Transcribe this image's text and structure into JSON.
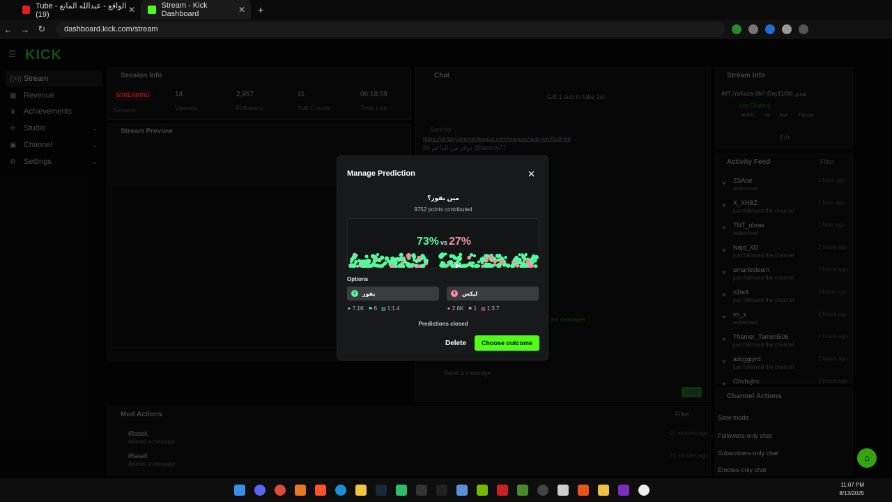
{
  "browser": {
    "tabs": [
      {
        "label": "Tube - الواقع - عبدالله المانع (19)",
        "color": "#e02020"
      },
      {
        "label": "Stream - Kick Dashboard",
        "color": "#53fc18"
      }
    ],
    "url": "dashboard.kick.com/stream"
  },
  "app": {
    "logo": "KICK",
    "sidebar": [
      {
        "label": "Stream",
        "icon": "broadcast-icon"
      },
      {
        "label": "Revenue",
        "icon": "dollar-icon"
      },
      {
        "label": "Achievements",
        "icon": "trophy-icon"
      },
      {
        "label": "Studio",
        "icon": "studio-icon"
      },
      {
        "label": "Channel",
        "icon": "channel-icon"
      },
      {
        "label": "Settings",
        "icon": "gear-icon"
      }
    ],
    "session_info": {
      "title": "Session Info",
      "badge": "STREAMING",
      "badge_sub": "Session",
      "stats": [
        {
          "value": "14",
          "label": "Viewers"
        },
        {
          "value": "2,957",
          "label": "Followers"
        },
        {
          "value": "11",
          "label": "Sub Counts"
        },
        {
          "value": "08:18:59",
          "label": "Time Live"
        }
      ]
    },
    "stream_preview": {
      "title": "Stream Preview"
    },
    "chat": {
      "title": "Chat",
      "gift": "Gift 1 sub to take 1st",
      "sent_by": "Sent by",
      "link": "https://fantasy.premierleague.com/leagues/auto-join/5o8n6d",
      "message_tail": "50 دولار من الداعم @kenroy77",
      "new_messages": "ew messages",
      "placeholder": "Send a message",
      "send": "Chat"
    },
    "stream_info": {
      "title": "Stream Info",
      "stream_title": "IMT |YaKuza |3k? |Day11/30| تحدي",
      "category": "Just Chatting",
      "tags": [
        "Arabic",
        "mt",
        "ksa",
        "Yakuza"
      ],
      "edit": "Edit"
    },
    "activity_feed": {
      "title": "Activity Feed",
      "filter": "Filter",
      "items": [
        {
          "name": "ZSAoe",
          "sub": "redeemed",
          "time": "1 hour ago"
        },
        {
          "name": "X_XHBZ",
          "sub": "just followed the channel",
          "time": "1 hour ago"
        },
        {
          "name": "TNT_nbras",
          "sub": "redeemed",
          "time": "1 hour ago"
        },
        {
          "name": "Najd_XD",
          "sub": "just followed the channel",
          "time": "2 hours ago"
        },
        {
          "name": "umartesleem",
          "sub": "just followed the channel",
          "time": "2 hours ago"
        },
        {
          "name": "n1le4",
          "sub": "just followed the channel",
          "time": "2 hours ago"
        },
        {
          "name": "vn_x",
          "sub": "redeemed",
          "time": "2 hours ago"
        },
        {
          "name": "Thamer_Tamimi506",
          "sub": "just followed the channel",
          "time": "2 hours ago"
        },
        {
          "name": "adcggtyrd",
          "sub": "just followed the channel",
          "time": "2 hours ago"
        },
        {
          "name": "Ghvhvjhv",
          "sub": "",
          "time": "2 hours ago"
        }
      ]
    },
    "mod_actions": {
      "title": "Mod Actions",
      "filter": "Filter",
      "items": [
        {
          "name": "iRaseil.",
          "sub": "deleted a message",
          "time": "21 minutes ago"
        },
        {
          "name": "iRaseil.",
          "sub": "deleted a message",
          "time": "21 minutes ago"
        }
      ]
    },
    "channel_actions": {
      "title": "Channel Actions",
      "items": [
        "Slow mode",
        "Followers-only chat",
        "Subscribers-only chat",
        "Emotes-only chat"
      ]
    }
  },
  "modal": {
    "title": "Manage Prediction",
    "question": "مين بفوز؟",
    "points": "9752 points contributed",
    "pct_a": "73%",
    "vs": "vs",
    "pct_b": "27%",
    "share_a": 0.73,
    "color_a": "#53fc9a",
    "color_b": "#f58fa3",
    "options_label": "Options",
    "options": [
      {
        "num": "1",
        "label": "يفوز",
        "stats": [
          "7.1K",
          "6",
          "1:1.4"
        ]
      },
      {
        "num": "2",
        "label": "ليكس",
        "stats": [
          "2.6K",
          "1",
          "1:3.7"
        ]
      }
    ],
    "status": "Predictions closed",
    "delete": "Delete",
    "choose": "Choose outcome"
  },
  "taskbar": {
    "time": "11:07 PM",
    "date": "8/13/2025"
  }
}
